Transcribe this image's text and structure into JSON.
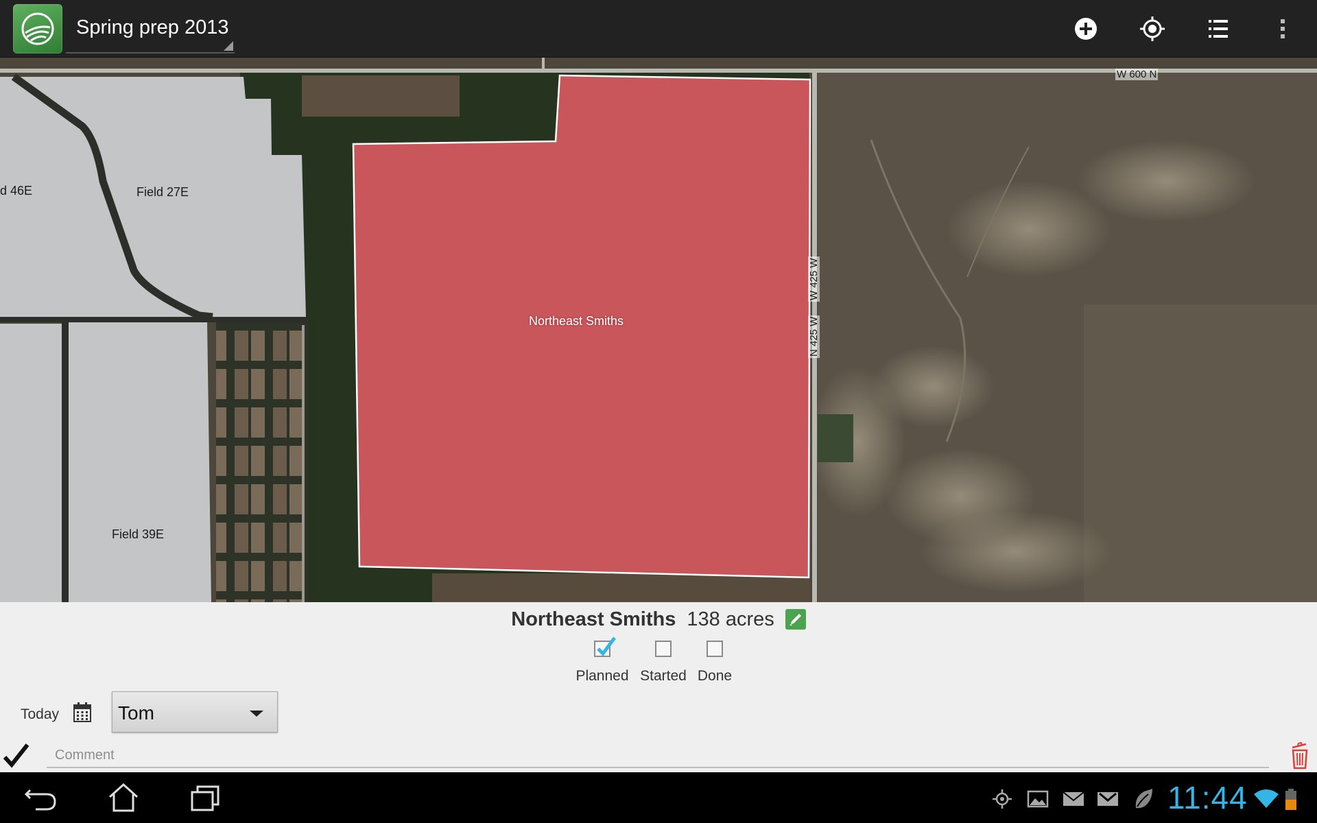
{
  "app": {
    "title": "Spring prep 2013",
    "icon": "farm-logo-icon"
  },
  "actionbar": {
    "actions": [
      "add-icon",
      "locate-icon",
      "list-icon",
      "overflow-menu-icon"
    ]
  },
  "map": {
    "field_labels": {
      "field_46e": "d 46E",
      "field_27e": "Field 27E",
      "field_39e": "Field 39E",
      "selected": "Northeast Smiths"
    },
    "road_labels": {
      "w600n": "W 600 N",
      "n425w": "N 425 W",
      "w425w": "W 425 W"
    },
    "colors": {
      "selected_field": "#c9565a",
      "other_fields": "#c3c5c7"
    }
  },
  "panel": {
    "field_name": "Northeast Smiths",
    "acres": "138 acres",
    "statuses": [
      {
        "label": "Planned",
        "checked": true
      },
      {
        "label": "Started",
        "checked": false
      },
      {
        "label": "Done",
        "checked": false
      }
    ],
    "date": "Today",
    "assignee": "Tom",
    "comment_placeholder": "Comment"
  },
  "sysbar": {
    "time": "11:44",
    "accent": "#33b5e5"
  }
}
